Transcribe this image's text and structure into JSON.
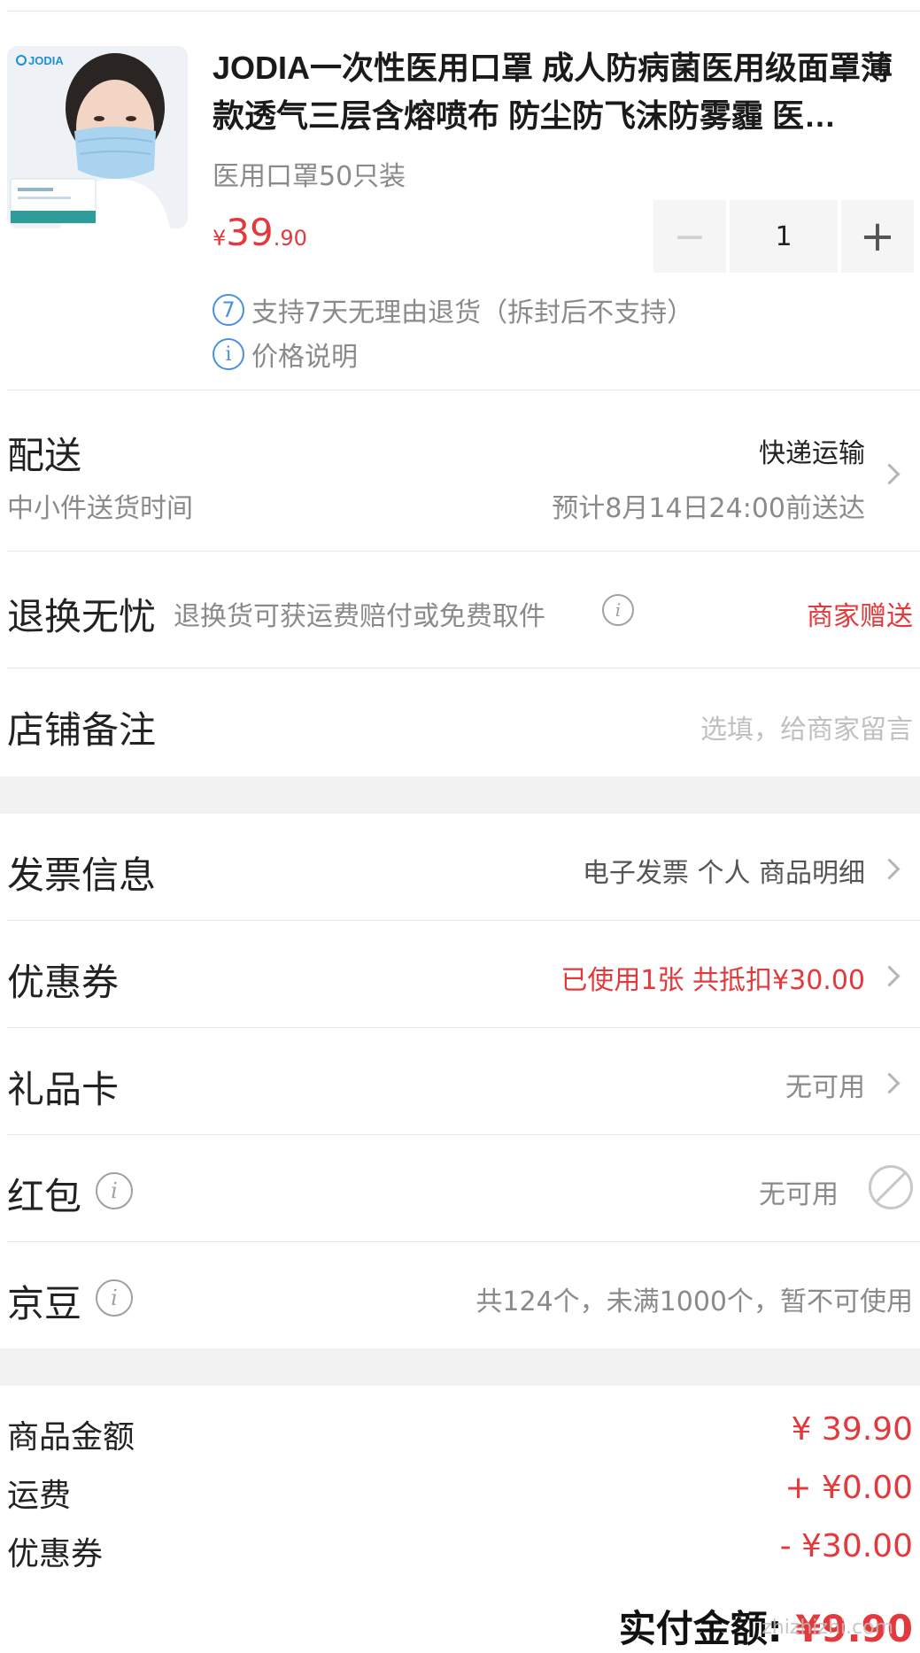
{
  "product": {
    "brand": "JODIA",
    "title": "JODIA一次性医用口罩 成人防病菌医用级面罩薄款透气三层含熔喷布 防尘防飞沫防雾霾 医…",
    "variant": "医用口罩50只装",
    "price_symbol": "¥",
    "price_int": "39",
    "price_dec": ".90",
    "quantity": "1",
    "minus_label": "−",
    "plus_label": "+",
    "return_badge": "7",
    "return_policy": "支持7天无理由退货（拆封后不支持）",
    "price_note_icon": "i",
    "price_note": "价格说明"
  },
  "delivery": {
    "title": "配送",
    "subtitle": "中小件送货时间",
    "method": "快递运输",
    "eta": "预计8月14日24:00前送达"
  },
  "returns": {
    "title": "退换无忧",
    "desc": "退换货可获运费赔付或免费取件",
    "value": "商家赠送"
  },
  "remark": {
    "title": "店铺备注",
    "placeholder": "选填，给商家留言"
  },
  "invoice": {
    "title": "发票信息",
    "value": "电子发票 个人 商品明细"
  },
  "coupon": {
    "title": "优惠券",
    "value": "已使用1张 共抵扣¥30.00"
  },
  "giftcard": {
    "title": "礼品卡",
    "value": "无可用"
  },
  "redpacket": {
    "title": "红包",
    "value": "无可用"
  },
  "jingdou": {
    "title": "京豆",
    "value": "共124个，未满1000个，暂不可使用"
  },
  "summary": {
    "items": [
      {
        "label": "商品金额",
        "value": "¥ 39.90"
      },
      {
        "label": "运费",
        "value": "+ ¥0.00"
      },
      {
        "label": "优惠券",
        "value": "- ¥30.00"
      }
    ],
    "total_label": "实付金额:",
    "total_value": "¥9.90"
  },
  "watermark": "zhizhizhi.com",
  "colors": {
    "accent": "#e4393c",
    "info_blue": "#4a90e2",
    "band": "#f2f2f2"
  },
  "icons": [
    "product-image",
    "return-7day-icon",
    "info-icon",
    "chevron-right-icon",
    "disabled-icon"
  ]
}
